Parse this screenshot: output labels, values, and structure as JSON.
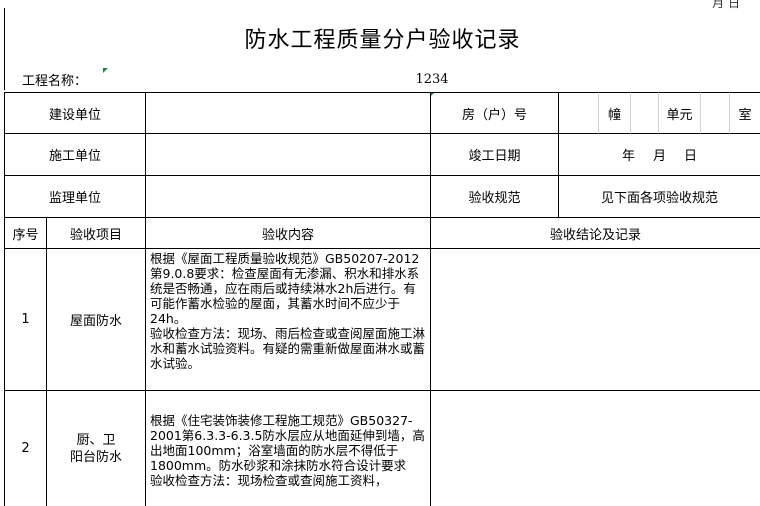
{
  "corner_text": "月 日",
  "title": "防水工程质量分户验收记录",
  "project": {
    "label": "工程名称：",
    "value": "1234"
  },
  "rows": {
    "construction": "建设单位",
    "room_no": "房（户）号",
    "building": "幢",
    "unit": "单元",
    "room": "室",
    "contractor": "施工单位",
    "completion_date": "竣工日期",
    "year": "年",
    "month": "月",
    "day": "日",
    "supervisor": "监理单位",
    "spec": "验收规范",
    "spec_value": "见下面各项验收规范"
  },
  "headers": {
    "no": "序号",
    "item": "验收项目",
    "content": "验收内容",
    "conclusion": "验收结论及记录"
  },
  "items": [
    {
      "no": "1",
      "name": "屋面防水",
      "content": "根据《屋面工程质量验收规范》GB50207-2012第9.0.8要求：检查屋面有无渗漏、积水和排水系统是否畅通，应在雨后或持续淋水2h后进行。有可能作蓄水检验的屋面，其蓄水时间不应少于24h。\n验收检查方法：现场、雨后检查或查阅屋面施工淋水和蓄水试验资料。有疑的需重新做屋面淋水或蓄水试验。"
    },
    {
      "no": "2",
      "name": "厨、卫\n阳台防水",
      "content": "根据《住宅装饰装修工程施工规范》GB50327-2001第6.3.3-6.3.5防水层应从地面延伸到墙，高出地面100mm；浴室墙面的防水层不得低于1800mm。防水砂浆和涂抹防水符合设计要求\n验收检查方法：现场检查或查阅施工资料，"
    }
  ]
}
